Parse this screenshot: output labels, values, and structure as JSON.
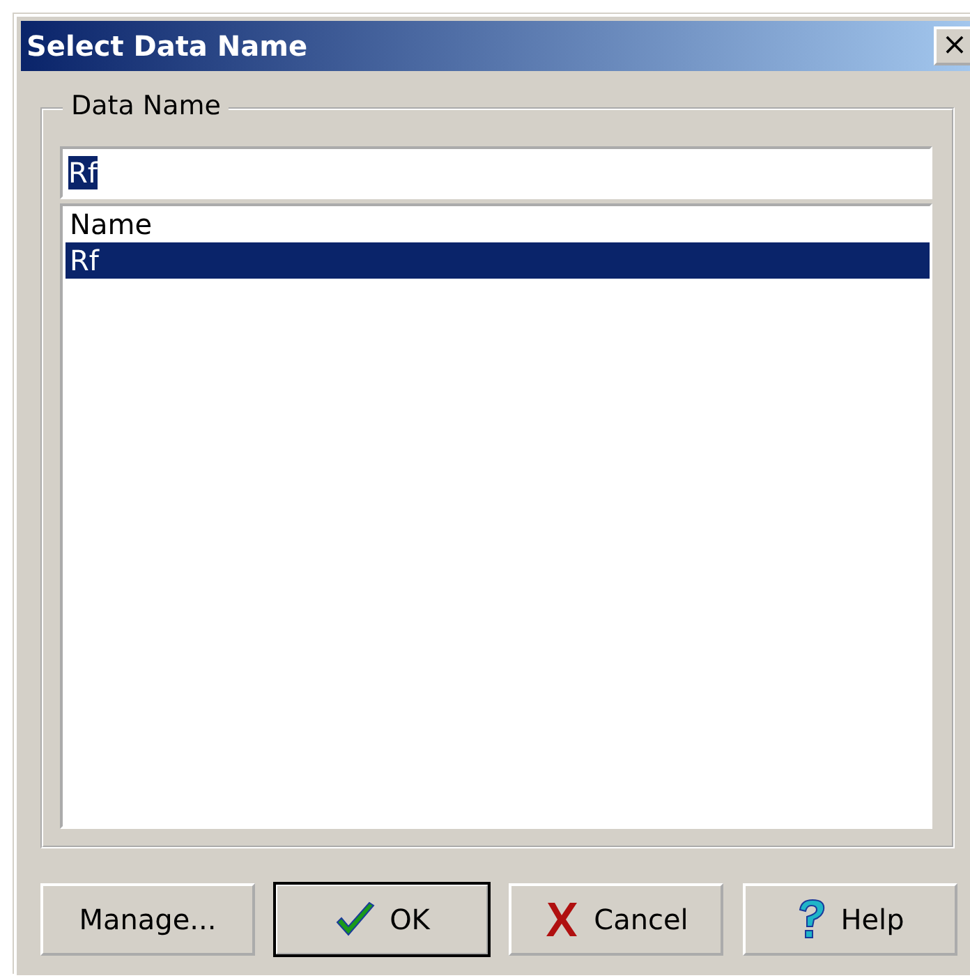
{
  "window": {
    "title": "Select Data Name",
    "close": "×"
  },
  "group": {
    "label": "Data Name"
  },
  "input": {
    "value": "Rf",
    "text_selected": true
  },
  "list": {
    "items": [
      {
        "label": "Name",
        "selected": false
      },
      {
        "label": "Rf",
        "selected": true
      }
    ]
  },
  "buttons": [
    {
      "label": "Manage...",
      "kind": "plain",
      "default": false
    },
    {
      "label": "OK",
      "kind": "ok",
      "default": true
    },
    {
      "label": "Cancel",
      "kind": "cancel",
      "default": false
    },
    {
      "label": "Help",
      "kind": "help",
      "default": false
    }
  ]
}
